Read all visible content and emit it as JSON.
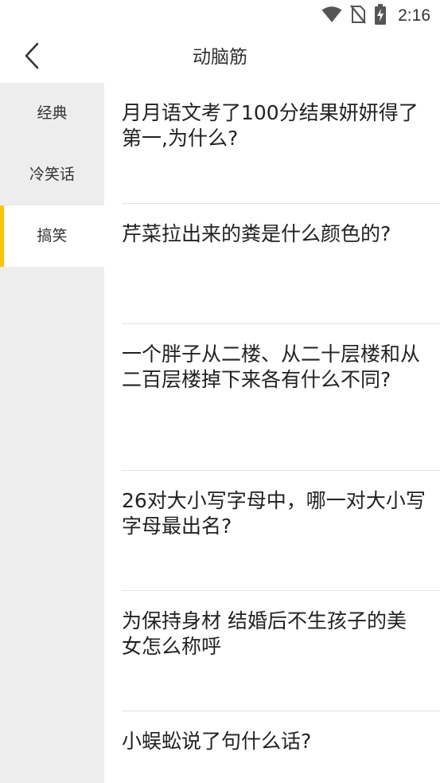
{
  "status_bar": {
    "time": "2:16",
    "icons": [
      "wifi-icon",
      "no-sim-icon",
      "battery-charging-icon"
    ]
  },
  "nav": {
    "title": "动脑筋",
    "back_icon": "chevron-left-icon"
  },
  "sidebar": {
    "items": [
      {
        "label": "经典",
        "active": false
      },
      {
        "label": "冷笑话",
        "active": false
      },
      {
        "label": "搞笑",
        "active": true
      }
    ],
    "accent_color": "#ffc400"
  },
  "questions": [
    "月月语文考了100分结果妍妍得了第一,为什么?",
    "芹菜拉出来的粪是什么颜色的?",
    "一个胖子从二楼、从二十层楼和从二百层楼掉下来各有什么不同?",
    "26对大小写字母中，哪一对大小写字母最出名?",
    "为保持身材 结婚后不生孩子的美女怎么称呼",
    "小蜈蚣说了句什么话?"
  ]
}
